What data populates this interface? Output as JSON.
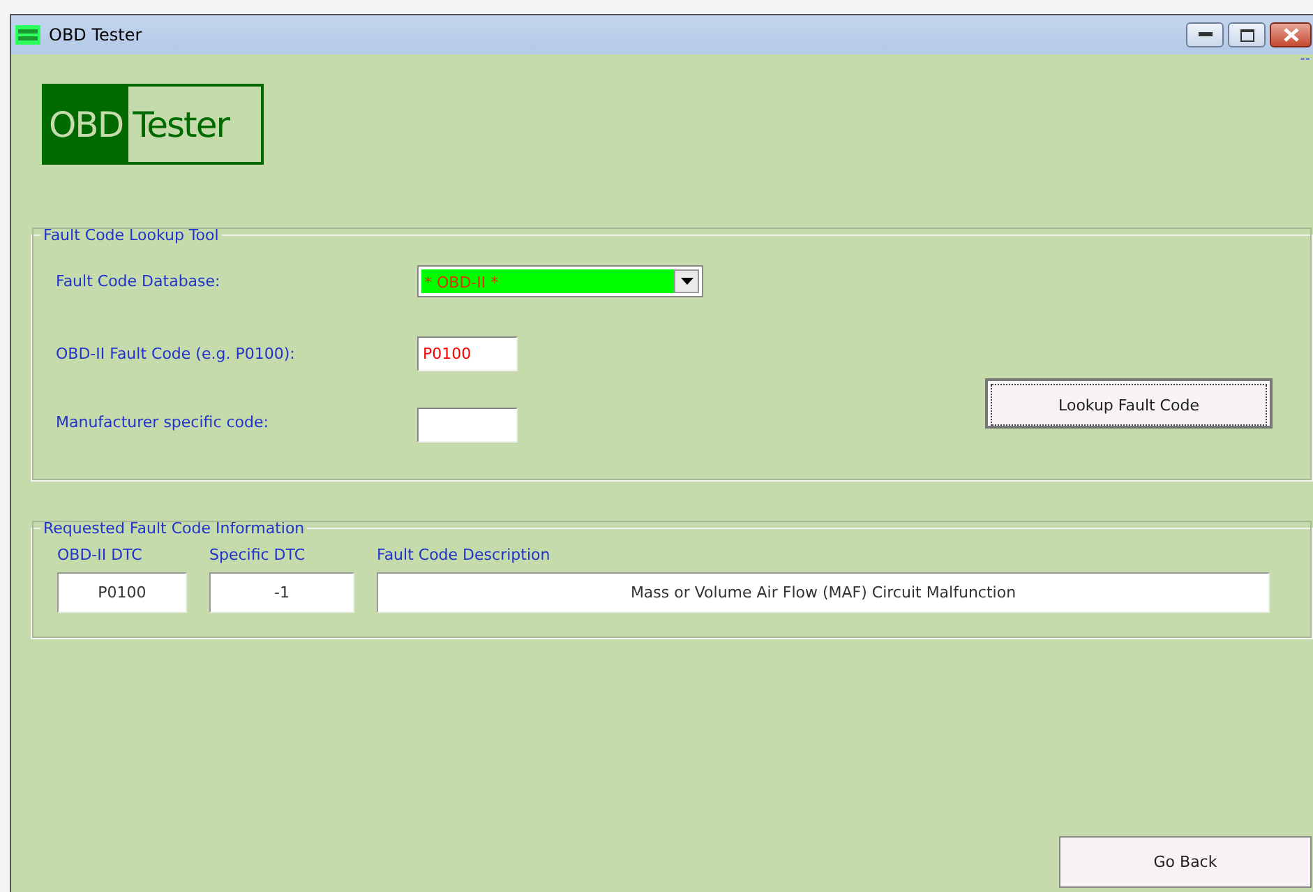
{
  "window": {
    "title": "OBD Tester",
    "corner_mark": "--"
  },
  "logo": {
    "left": "OBD",
    "right": "Tester"
  },
  "lookup_group": {
    "title": "Fault Code Lookup Tool",
    "database": {
      "label": "Fault Code Database:",
      "value": "* OBD-II *"
    },
    "obd_code": {
      "label": "OBD-II Fault Code (e.g. P0100):",
      "value": "P0100"
    },
    "manufacturer_code": {
      "label": "Manufacturer specific code:"
    },
    "button": "Lookup Fault Code"
  },
  "info_group": {
    "title": "Requested Fault Code Information",
    "columns": [
      {
        "header": "OBD-II DTC",
        "value": "P0100",
        "kind": "short"
      },
      {
        "header": "Specific DTC",
        "value": "-1",
        "kind": "short"
      },
      {
        "header": "Fault Code Description",
        "value": "Mass or Volume Air Flow (MAF) Circuit Malfunction",
        "kind": "wide"
      }
    ]
  },
  "back_button": "Go Back"
}
